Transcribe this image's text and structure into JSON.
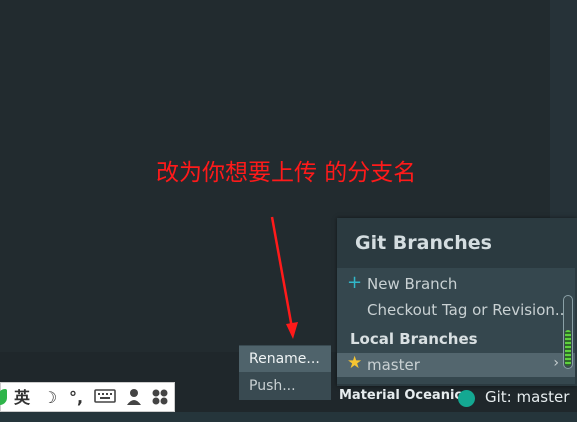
{
  "annotation": {
    "text": "改为你想要上传 的分支名",
    "color": "#ff1a1a"
  },
  "git_branches": {
    "title": "Git Branches",
    "actions": [
      "New Branch",
      "Checkout Tag or Revision..."
    ],
    "local_header": "Local Branches",
    "local_branches": [
      {
        "name": "master",
        "current": true
      }
    ]
  },
  "branch_submenu": {
    "items": [
      "Rename...",
      "Push..."
    ],
    "active_index": 0
  },
  "status_bar": {
    "theme": "Material Oceanic",
    "git_branch": "Git: master"
  },
  "ime_toolbar": {
    "lang": "英",
    "icons": [
      "leaf-logo-icon",
      "moon-icon",
      "punctuation-icon",
      "keyboard-icon",
      "user-voice-icon",
      "settings-grid-icon"
    ]
  },
  "colors": {
    "accent": "#31b7c9",
    "star": "#f6c531",
    "theme_dot": "#14a892",
    "scroll_fill": "#5ed23d"
  }
}
